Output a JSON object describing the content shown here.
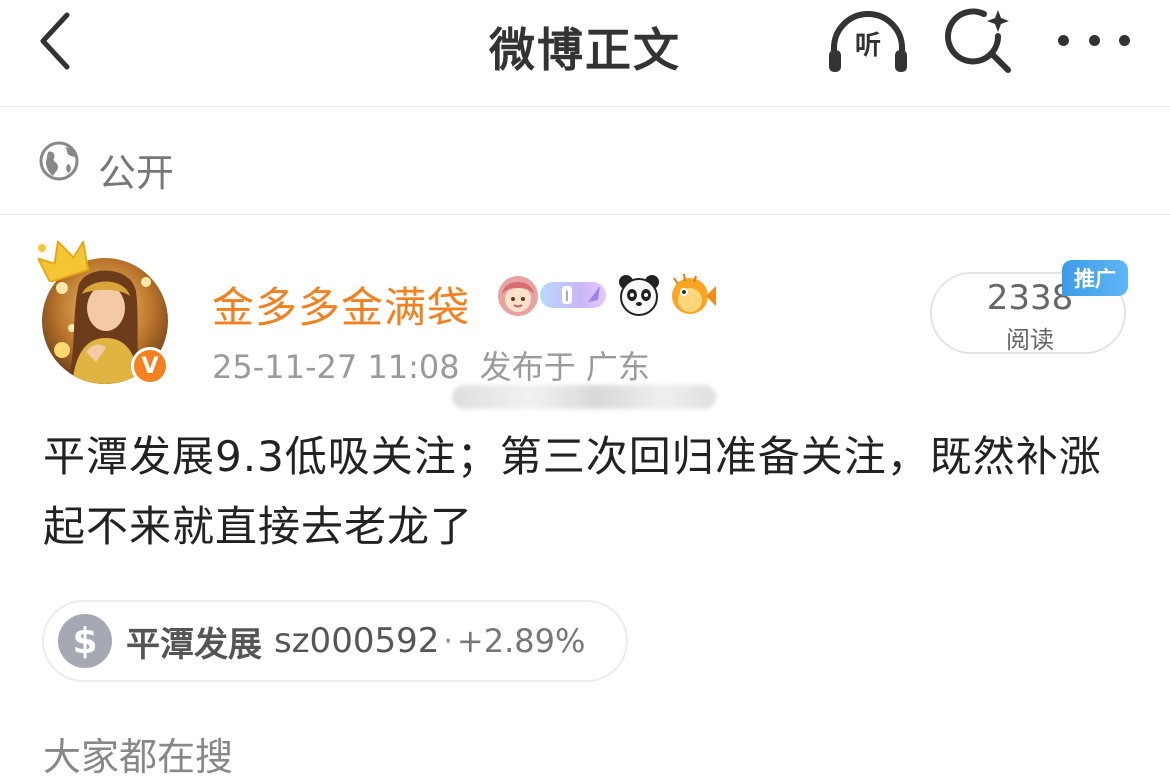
{
  "navbar": {
    "title": "微博正文",
    "listen_label": "听",
    "icons": {
      "back": "chevron-left-icon",
      "listen": "headphones-icon",
      "search": "search-sparkle-icon",
      "more": "more-dots-icon"
    }
  },
  "visibility": {
    "icon": "globe-icon",
    "label": "公开"
  },
  "post": {
    "author": {
      "name": "金多多金满袋",
      "verified_badge": "V",
      "badges": [
        "girl-sticker-icon",
        "level-badge-icon",
        "panda-icon",
        "pufferfish-icon"
      ]
    },
    "timestamp": "25-11-27 11:08",
    "location": "发布于 广东",
    "read_count": "2338",
    "read_label": "阅读",
    "promo_tag": "推广",
    "text": "平潭发展9.3低吸关注；第三次回归准备关注，既然补涨起不来就直接去老龙了",
    "stock": {
      "symbol_icon": "$",
      "name": "平潭发展",
      "code": "sz000592",
      "separator": "·",
      "change": "+2.89%"
    }
  },
  "trending": {
    "heading": "大家都在搜"
  },
  "colors": {
    "accent_orange": "#f2801f",
    "promo_blue": "#3d9bea",
    "text_gray": "#9a9a9a"
  }
}
